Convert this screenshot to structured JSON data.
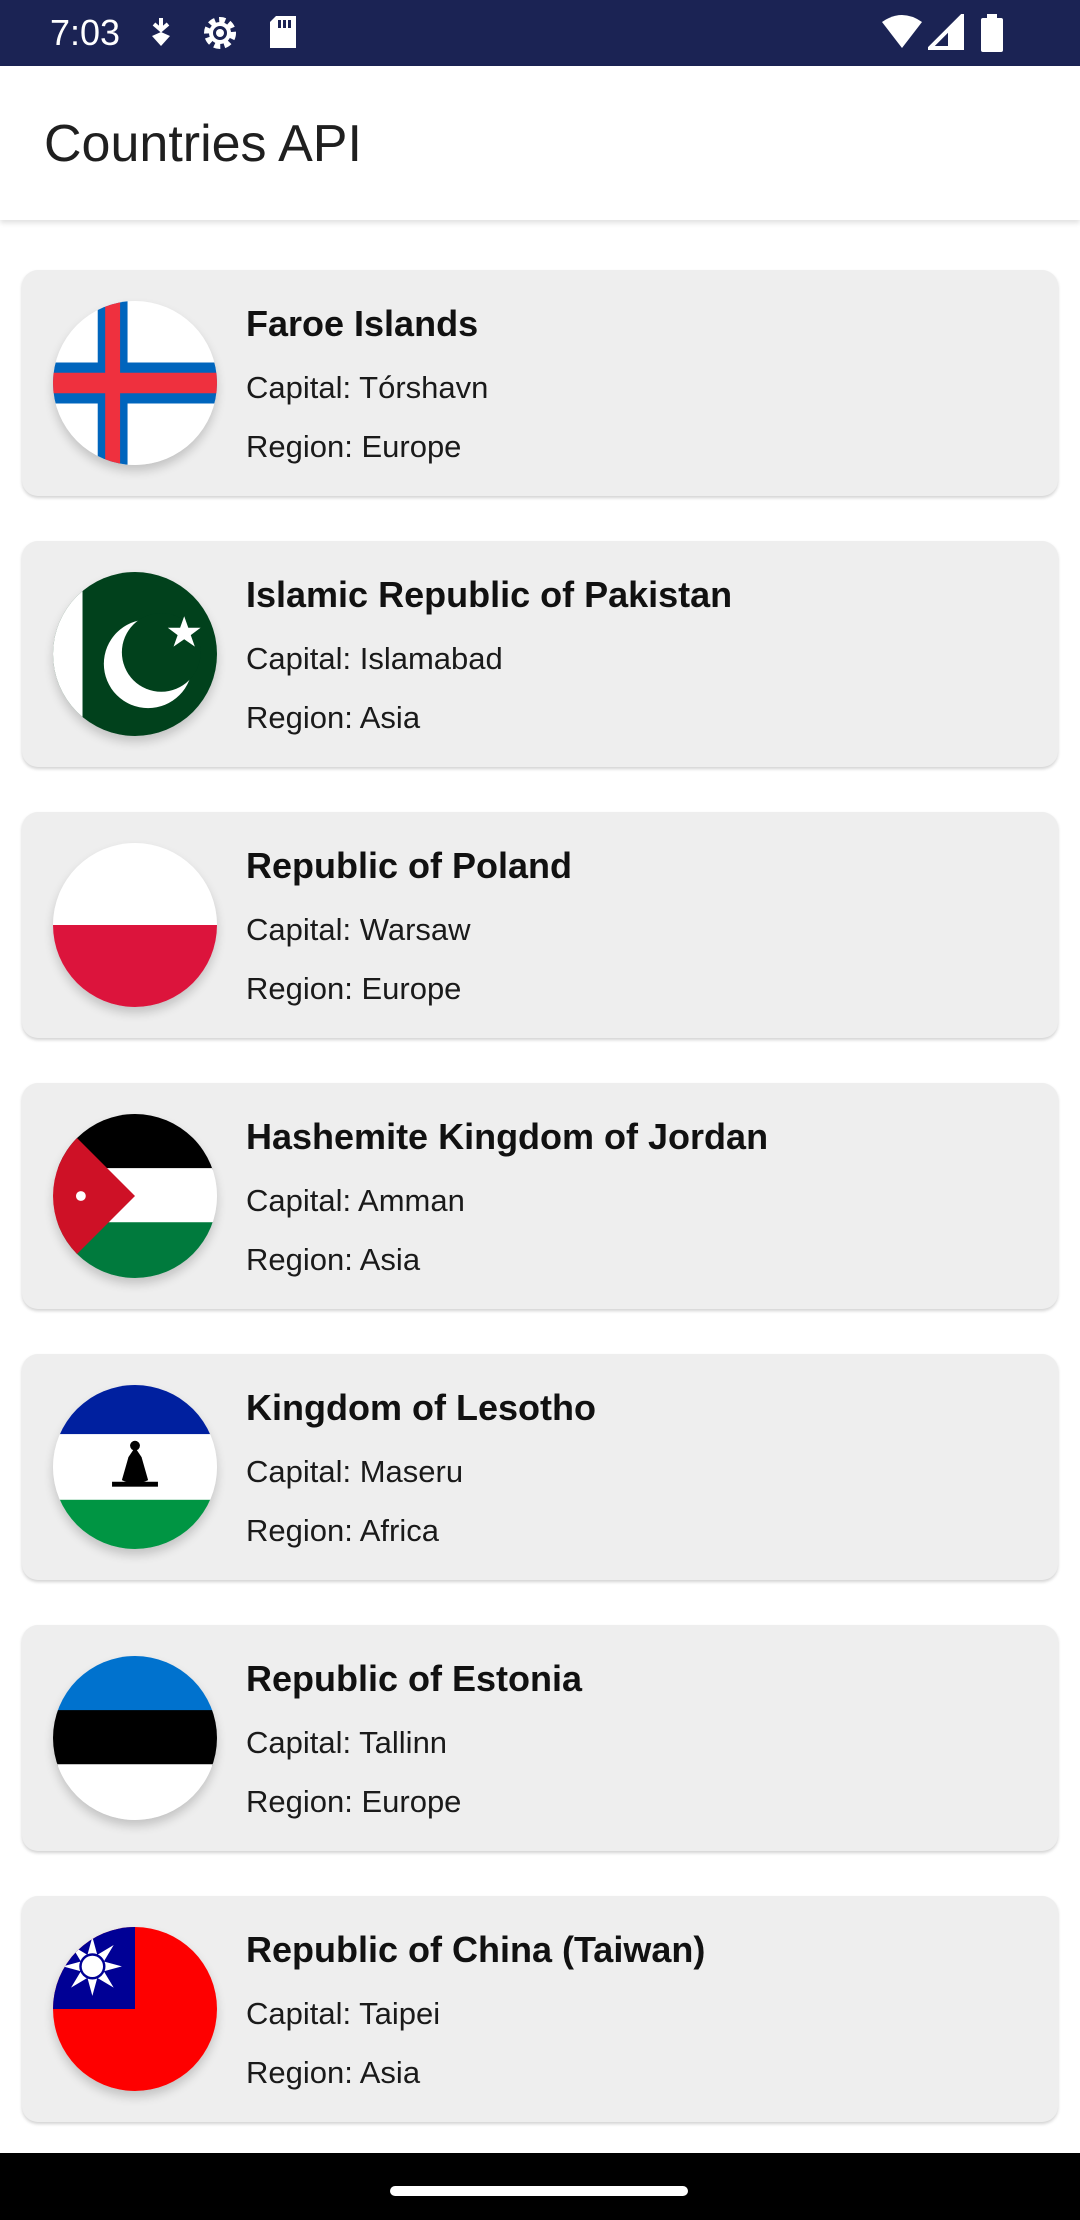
{
  "status_bar": {
    "time": "7:03",
    "left_icons": [
      "data-saver-icon",
      "settings-gear-icon",
      "sd-card-icon"
    ],
    "right_icons": [
      "wifi-icon",
      "signal-icon",
      "battery-icon"
    ]
  },
  "app_bar": {
    "title": "Countries API"
  },
  "countries": [
    {
      "name": "Faroe Islands",
      "capital": "Capital: Tórshavn",
      "region": "Region: Europe",
      "flag_icon": "faroe-islands-flag-icon"
    },
    {
      "name": "Islamic Republic of Pakistan",
      "capital": "Capital: Islamabad",
      "region": "Region: Asia",
      "flag_icon": "pakistan-flag-icon"
    },
    {
      "name": "Republic of Poland",
      "capital": "Capital: Warsaw",
      "region": "Region: Europe",
      "flag_icon": "poland-flag-icon"
    },
    {
      "name": "Hashemite Kingdom of Jordan",
      "capital": "Capital: Amman",
      "region": "Region: Asia",
      "flag_icon": "jordan-flag-icon"
    },
    {
      "name": "Kingdom of Lesotho",
      "capital": "Capital: Maseru",
      "region": "Region: Africa",
      "flag_icon": "lesotho-flag-icon"
    },
    {
      "name": "Republic of Estonia",
      "capital": "Capital: Tallinn",
      "region": "Region: Europe",
      "flag_icon": "estonia-flag-icon"
    },
    {
      "name": "Republic of China (Taiwan)",
      "capital": "Capital: Taipei",
      "region": "Region: Asia",
      "flag_icon": "taiwan-flag-icon"
    }
  ],
  "colors": {
    "status_bar": "#1b2354",
    "app_bar": "#ffffff",
    "card": "#eeeeee",
    "nav_bar": "#000000"
  }
}
